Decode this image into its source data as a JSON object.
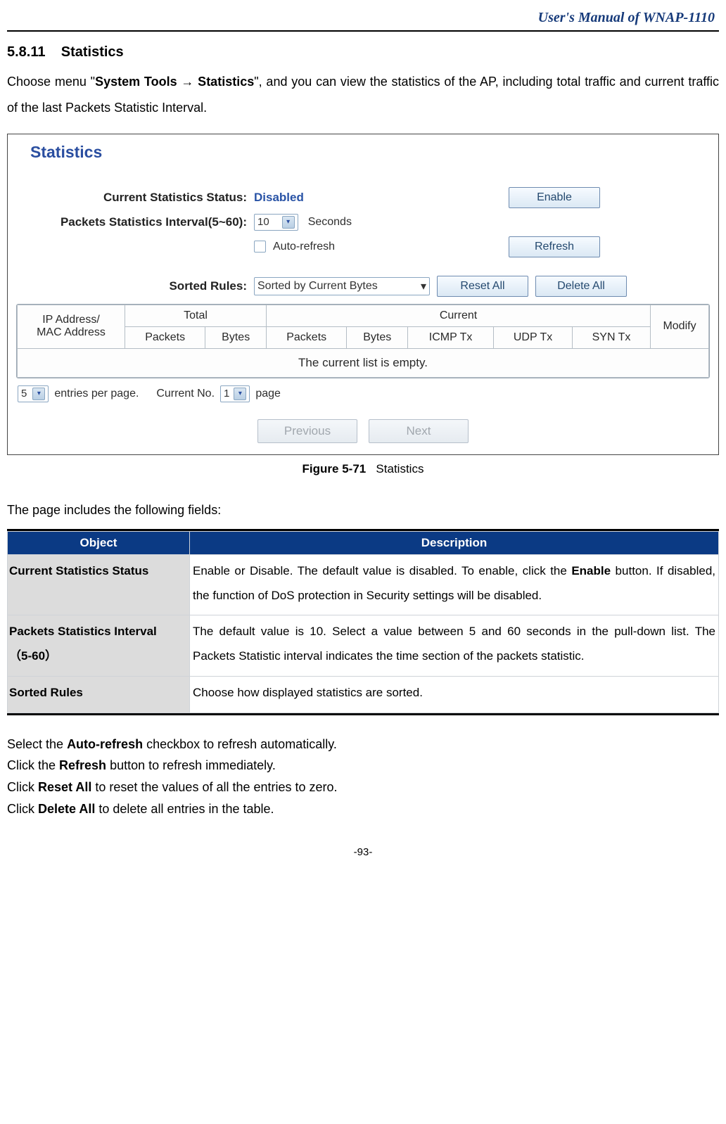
{
  "doc_header": "User's Manual of WNAP-1110",
  "section_number": "5.8.11",
  "section_title": "Statistics",
  "intro": {
    "prefix": "Choose menu \"",
    "menu_bold": "System Tools → Statistics",
    "suffix": "\", and you can view the statistics of the AP, including total traffic and current traffic of the last Packets Statistic Interval."
  },
  "screenshot": {
    "title": "Statistics",
    "labels": {
      "status": "Current Statistics Status:",
      "interval": "Packets Statistics Interval(5~60):",
      "sorted": "Sorted Rules:"
    },
    "status_value": "Disabled",
    "enable_btn": "Enable",
    "interval_value": "10",
    "seconds": "Seconds",
    "auto_refresh_label": "Auto-refresh",
    "refresh_btn": "Refresh",
    "sort_value": "Sorted by Current Bytes",
    "reset_btn": "Reset All",
    "delete_btn": "Delete All",
    "table": {
      "total": "Total",
      "current": "Current",
      "ipmac": "IP Address/\nMAC Address",
      "packets": "Packets",
      "bytes": "Bytes",
      "icmp": "ICMP Tx",
      "udp": "UDP Tx",
      "syn": "SYN Tx",
      "modify": "Modify",
      "empty": "The current list is empty."
    },
    "entries_value": "5",
    "entries_text": "entries per page.",
    "current_no": "Current No.",
    "page_value": "1",
    "page_text": "page",
    "prev_btn": "Previous",
    "next_btn": "Next"
  },
  "figure": {
    "num": "Figure 5-71",
    "caption": "Statistics"
  },
  "fields_lead": "The page includes the following fields:",
  "desc_table": {
    "headers": {
      "object": "Object",
      "description": "Description"
    },
    "rows": [
      {
        "object": "Current Statistics Status",
        "object_sub": "",
        "desc_pre": "Enable or Disable. The default value is disabled. To enable, click the ",
        "desc_bold": "Enable",
        "desc_post": " button. If disabled, the function of DoS protection in Security settings will be disabled."
      },
      {
        "object": "Packets Statistics Interval",
        "object_sub": "（5-60）",
        "desc_pre": "The default value is 10. Select a value between 5 and 60 seconds in the pull-down list. The Packets Statistic interval indicates the time section of the packets statistic.",
        "desc_bold": "",
        "desc_post": ""
      },
      {
        "object": "Sorted Rules",
        "object_sub": "",
        "desc_pre": "Choose how displayed statistics are sorted.",
        "desc_bold": "",
        "desc_post": ""
      }
    ]
  },
  "body_lines": {
    "l1_pre": "Select the ",
    "l1_bold": "Auto-refresh",
    "l1_post": " checkbox to refresh automatically.",
    "l2_pre": "Click the ",
    "l2_bold": "Refresh",
    "l2_post": " button to refresh immediately.",
    "l3_pre": "Click ",
    "l3_bold": "Reset All",
    "l3_post": " to reset the values of all the entries to zero.",
    "l4_pre": "Click ",
    "l4_bold": "Delete All",
    "l4_post": " to delete all entries in the table."
  },
  "page_number": "-93-"
}
